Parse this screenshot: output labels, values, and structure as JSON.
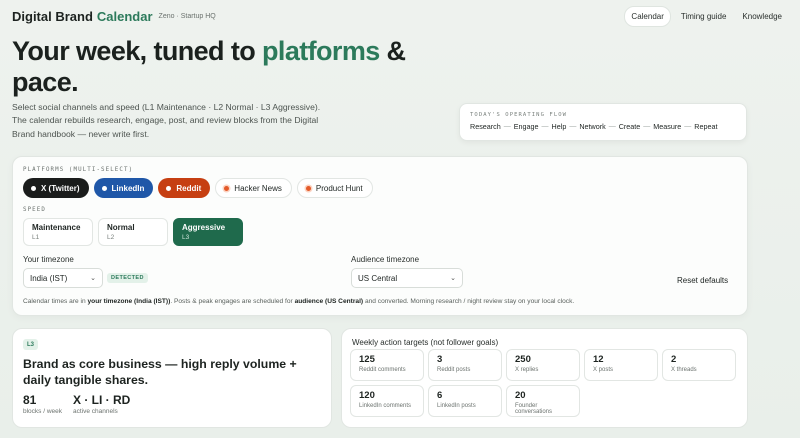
{
  "header": {
    "brand": "Digital Brand",
    "brand_accent": "Calendar",
    "subtitle": "Zeno · Startup HQ",
    "nav": [
      {
        "label": "Calendar",
        "active": true
      },
      {
        "label": "Timing guide",
        "active": false
      },
      {
        "label": "Knowledge",
        "active": false
      }
    ]
  },
  "hero": {
    "title_pre": "Your week, tuned to ",
    "title_highlight": "platforms",
    "title_post": " & pace.",
    "description": "Select social channels and speed (L1 Maintenance · L2 Normal · L3 Aggressive). The calendar rebuilds research, engage, post, and review blocks from the Digital Brand handbook — never write first."
  },
  "flow": {
    "label": "TODAY'S OPERATING FLOW",
    "steps": [
      "Research",
      "Engage",
      "Help",
      "Network",
      "Create",
      "Measure",
      "Repeat"
    ],
    "separator": "—"
  },
  "settings": {
    "platforms_label": "PLATFORMS (MULTI-SELECT)",
    "platforms": [
      {
        "label": "X (Twitter)",
        "selected": true,
        "color": "#1a1c1b"
      },
      {
        "label": "LinkedIn",
        "selected": true,
        "color": "#1f57a8"
      },
      {
        "label": "Reddit",
        "selected": true,
        "color": "#c63f12"
      },
      {
        "label": "Hacker News",
        "selected": false,
        "color": "#e45a2a"
      },
      {
        "label": "Product Hunt",
        "selected": false,
        "color": "#e45a2a"
      }
    ],
    "speed_label": "SPEED",
    "speeds": [
      {
        "name": "Maintenance",
        "level": "L1",
        "selected": false
      },
      {
        "name": "Normal",
        "level": "L2",
        "selected": false
      },
      {
        "name": "Aggressive",
        "level": "L3",
        "selected": true
      }
    ],
    "your_tz_label": "Your timezone",
    "your_tz_value": "India (IST)",
    "detected_badge": "DETECTED",
    "audience_tz_label": "Audience timezone",
    "audience_tz_value": "US Central",
    "reset_label": "Reset defaults",
    "note_1": "Calendar times are in ",
    "note_your_tz": "your timezone (India (IST))",
    "note_2": ". Posts & peak engages are scheduled for ",
    "note_audience": "audience (US Central)",
    "note_3": " and converted. Morning research / night review stay on your local clock."
  },
  "plan": {
    "badge": "L3",
    "title": "Brand as core business — high reply volume + daily tangible shares.",
    "stats": [
      {
        "value": "81",
        "label": "blocks / week"
      },
      {
        "value": "X · LI · RD",
        "label": "active channels"
      }
    ]
  },
  "targets": {
    "title": "Weekly action targets (not follower goals)",
    "items": [
      {
        "value": "125",
        "label": "Reddit comments"
      },
      {
        "value": "3",
        "label": "Reddit posts"
      },
      {
        "value": "250",
        "label": "X replies"
      },
      {
        "value": "12",
        "label": "X posts"
      },
      {
        "value": "2",
        "label": "X threads"
      },
      {
        "value": "120",
        "label": "LinkedIn comments"
      },
      {
        "value": "6",
        "label": "LinkedIn posts"
      },
      {
        "value": "20",
        "label": "Founder conversations"
      }
    ]
  },
  "colors": {
    "accent": "#2c7a5b",
    "speed_selected": "#1f6a4c"
  }
}
